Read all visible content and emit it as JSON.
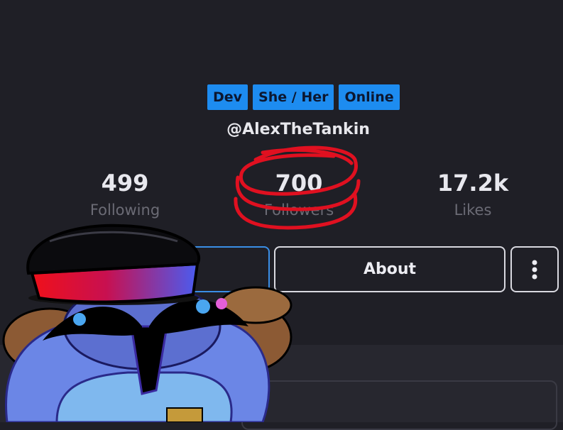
{
  "badges": [
    "Dev",
    "She / Her",
    "Online"
  ],
  "handle": "@AlexTheTankin",
  "stats": {
    "following": {
      "value": "499",
      "label": "Following"
    },
    "followers": {
      "value": "700",
      "label": "Followers"
    },
    "likes": {
      "value": "17.2k",
      "label": "Likes"
    }
  },
  "buttons": {
    "about_label": "About"
  },
  "colors": {
    "badge_bg": "#1d8cf0",
    "page_bg": "#1f1f26",
    "highlight_circle": "#e01020"
  }
}
